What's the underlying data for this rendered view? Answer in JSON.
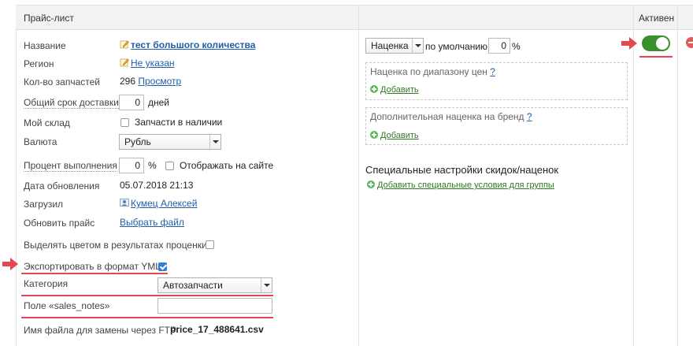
{
  "header": {
    "title": "Прайс-лист",
    "active_col": "Активен"
  },
  "fields": {
    "name": {
      "label": "Название",
      "value": "тест большого количества"
    },
    "region": {
      "label": "Регион",
      "value": "Не указан"
    },
    "parts_count": {
      "label": "Кол-во запчастей",
      "value": "296",
      "link": "Просмотр"
    },
    "delivery": {
      "label": "Общий срок доставки",
      "value": "0",
      "unit": "дней"
    },
    "my_stock": {
      "label": "Мой склад",
      "checkbox_label": "Запчасти в наличии",
      "checked": false
    },
    "currency": {
      "label": "Валюта",
      "value": "Рубль"
    },
    "completion": {
      "label": "Процент выполнения",
      "value": "0",
      "unit": "%",
      "checkbox_label": "Отображать на сайте",
      "checked": false
    },
    "updated": {
      "label": "Дата обновления",
      "value": "05.07.2018 21:13"
    },
    "uploaded": {
      "label": "Загрузил",
      "value": "Кумец Алексей"
    },
    "refresh": {
      "label": "Обновить прайс",
      "link": "Выбрать файл"
    },
    "highlight": {
      "label": "Выделять цветом в результатах проценки",
      "checked": false
    },
    "export_yml": {
      "label": "Экспортировать в формат YML",
      "checked": true
    },
    "category": {
      "label": "Категория",
      "value": "Автозапчасти"
    },
    "sales_notes": {
      "label": "Поле «sales_notes»",
      "value": ""
    },
    "ftp": {
      "label": "Имя файла для замены через FTP",
      "value": "price_17_488641.csv"
    }
  },
  "markup": {
    "select": "Наценка",
    "default_label": "по умолчанию",
    "value": "0",
    "unit": "%",
    "range_title": "Наценка по диапазону цен",
    "range_help": "?",
    "range_add": "Добавить",
    "brand_title": "Дополнительная наценка на бренд",
    "brand_help": "?",
    "brand_add": "Добавить",
    "special_title": "Специальные настройки скидок/наценок",
    "special_add": "Добавить специальные условия для группы"
  },
  "status": {
    "active": true
  },
  "colors": {
    "accent_red": "#e4474f",
    "toggle_green": "#3b8f2b",
    "link_blue": "#1f5ea8",
    "add_green": "#2f7a22"
  }
}
